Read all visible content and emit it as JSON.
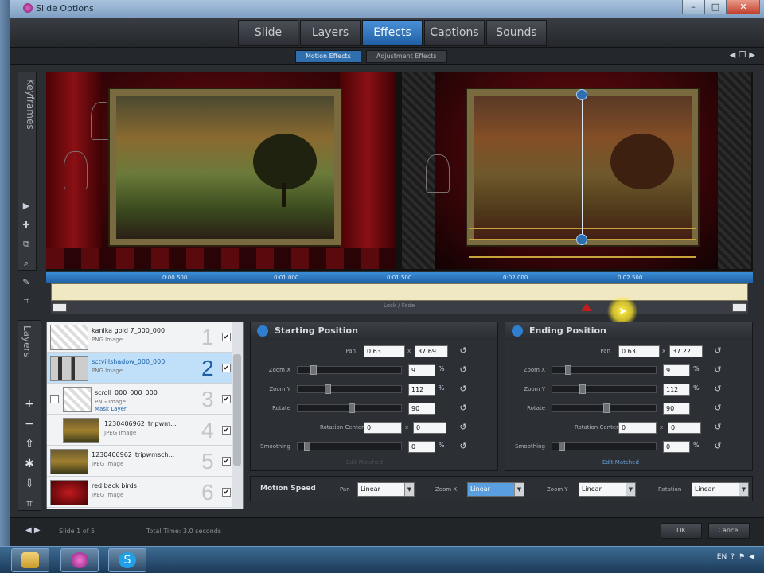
{
  "window": {
    "title": "Slide Options"
  },
  "winbtns": {
    "min": "–",
    "max": "□",
    "close": "✕"
  },
  "tabs": [
    {
      "label": "Slide"
    },
    {
      "label": "Layers"
    },
    {
      "label": "Effects"
    },
    {
      "label": "Captions"
    },
    {
      "label": "Sounds"
    }
  ],
  "subtabs": {
    "motion": "Motion Effects",
    "adjust": "Adjustment Effects"
  },
  "sidebar": {
    "keyframes": "Keyframes",
    "layers": "Layers"
  },
  "timeline": {
    "ticks": [
      "0:00.500",
      "0:01.000",
      "0:01.500",
      "0:02.000",
      "0:02.500"
    ],
    "caption": "Lock / Fade"
  },
  "layers": [
    {
      "name": "kanika gold 7_000_000",
      "type": "PNG Image",
      "num": "1",
      "sub": ""
    },
    {
      "name": "sctvillshadow_000_000",
      "type": "PNG Image",
      "num": "2",
      "sub": ""
    },
    {
      "name": "scroll_000_000_000",
      "type": "PNG Image",
      "num": "3",
      "sub": "Mask Layer"
    },
    {
      "name": "1230406962_tripwm...",
      "type": "JPEG Image",
      "num": "4",
      "sub": ""
    },
    {
      "name": "1230406962_tripwmsch...",
      "type": "JPEG Image",
      "num": "5",
      "sub": ""
    },
    {
      "name": "red back birds",
      "type": "JPEG Image",
      "num": "6",
      "sub": ""
    }
  ],
  "start": {
    "title": "Starting Position",
    "pan_label": "Pan",
    "pan_x": "0.63",
    "pan_y": "37.69",
    "zoomx_label": "Zoom X",
    "zoomx": "9",
    "zoomy_label": "Zoom Y",
    "zoomy": "112",
    "rotate_label": "Rotate",
    "rotate": "90",
    "rc_label": "Rotation Center",
    "rc_x": "0",
    "rc_y": "0",
    "smooth_label": "Smoothing",
    "smooth": "0",
    "link": "Edit Matched"
  },
  "end": {
    "title": "Ending Position",
    "pan_label": "Pan",
    "pan_x": "0.63",
    "pan_y": "37.22",
    "zoomx_label": "Zoom X",
    "zoomx": "9",
    "zoomy_label": "Zoom Y",
    "zoomy": "112",
    "rotate_label": "Rotate",
    "rotate": "90",
    "rc_label": "Rotation Center",
    "rc_x": "0",
    "rc_y": "0",
    "smooth_label": "Smoothing",
    "smooth": "0",
    "link": "Edit Matched"
  },
  "motion_speed": {
    "title": "Motion Speed",
    "pan_label": "Pan",
    "pan_val": "Linear",
    "zoomx_label": "Zoom X",
    "zoomx_val": "Linear",
    "zoomy_label": "Zoom Y",
    "zoomy_val": "Linear",
    "rotation_label": "Rotation",
    "rotation_val": "Linear"
  },
  "footer": {
    "slide": "Slide 1 of 5",
    "total": "Total Time: 3.0 seconds",
    "ok": "OK",
    "cancel": "Cancel"
  },
  "tray": {
    "lang": "EN",
    "time": ""
  },
  "colors": {
    "accent": "#2f6fae",
    "track": "#efe8c2",
    "marker": "#c21e1e",
    "highlight": "#ffee44"
  },
  "icons": [
    "app-icon",
    "play-icon",
    "add-keyframe-icon",
    "duplicate-icon",
    "zoom-icon",
    "magic-icon",
    "reset-icon",
    "add-layer-icon",
    "remove-layer-icon",
    "move-up-icon",
    "move-down-icon",
    "layer-options-icon",
    "folder-icon",
    "skype-icon"
  ]
}
